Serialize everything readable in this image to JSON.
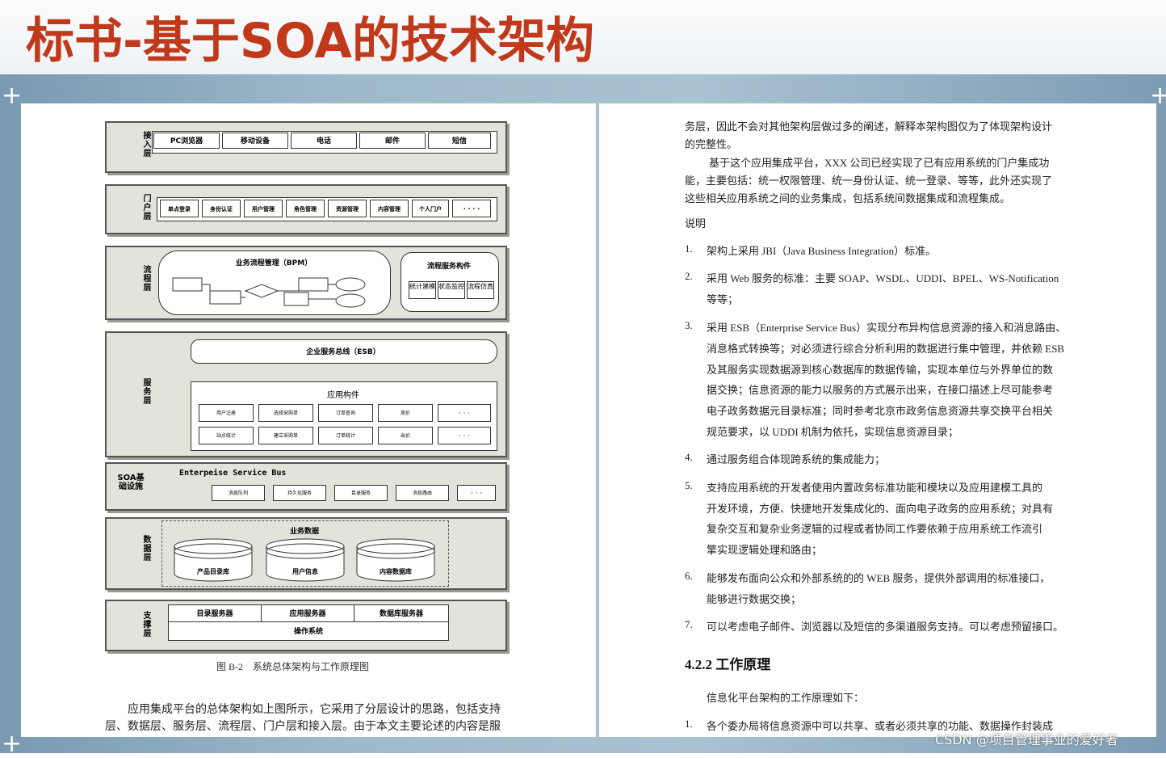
{
  "slide_title": "标书-基于SOA的技术架构",
  "diagram": {
    "access_layer": {
      "label": "接入层",
      "items": [
        "PC浏览器",
        "移动设备",
        "电话",
        "邮件",
        "短信"
      ]
    },
    "portal_layer": {
      "label": "门户层",
      "items": [
        "单点登录",
        "身份认证",
        "用户管理",
        "角色管理",
        "资源管理",
        "内容管理",
        "个人门户",
        "· · · ·"
      ]
    },
    "process_layer": {
      "label": "流程层",
      "bpm_title": "业务流程管理（BPM）",
      "components_title": "流程服务构件",
      "components": [
        "统计建模",
        "状态监控",
        "流程仿真"
      ]
    },
    "service_layer": {
      "label": "服务层",
      "esb": "企业服务总线（ESB）",
      "app_title": "应用构件",
      "row1": [
        "用户注册",
        "选择采购单",
        "订单查询",
        "竞价",
        "· · ·"
      ],
      "row2": [
        "站点统计",
        "建立采购单",
        "订单统计",
        "出价",
        "· · ·"
      ]
    },
    "soa_layer": {
      "label": "SOA基础设施",
      "bus": "Enterpeise Service Bus",
      "items": [
        "消息队列",
        "持久化服务",
        "目录服务",
        "消息路由",
        "· · ·"
      ]
    },
    "data_layer": {
      "label": "数据层",
      "title": "业务数据",
      "dbs": [
        "产品目录库",
        "用户信息",
        "内容数据库"
      ]
    },
    "support_layer": {
      "label": "支撑层",
      "items": [
        "目录服务器",
        "应用服务器",
        "数据库服务器"
      ],
      "os": "操作系统"
    },
    "caption": "图 B-2　系统总体架构与工作原理图"
  },
  "left_text": [
    "应用集成平台的总体架构如上图所示，它采用了分层设计的思路，包括支持",
    "层、数据层、服务层、流程层、门户层和接入层。由于本文主要论述的内容是服"
  ],
  "right_text": {
    "p1": [
      "务层，因此不会对其他架构层做过多的阐述，解释本架构图仅为了体现架构设计",
      "的完整性。"
    ],
    "p2": [
      "基于这个应用集成平台，XXX 公司已经实现了已有应用系统的门户集成功",
      "能，主要包括：统一权限管理、统一身份认证、统一登录、等等，此外还实现了",
      "这些相关应用系统之间的业务集成，包括系统间数据集成和流程集成。"
    ],
    "note": "说明",
    "items": [
      {
        "num": "1.",
        "lines": [
          "架构上采用 JBI（Java Business Integration）标准。"
        ]
      },
      {
        "num": "2.",
        "lines": [
          "采用 Web 服务的标准：主要 SOAP、WSDL、UDDI、BPEL、WS-Notification",
          "等等；"
        ]
      },
      {
        "num": "3.",
        "lines": [
          "采用 ESB（Enterprise Service Bus）实现分布异构信息资源的接入和消息路由、",
          "消息格式转换等；对必须进行综合分析利用的数据进行集中管理，并依赖 ESB",
          "及其服务实现数据源到核心数据库的数据传输，实现本单位与外界单位的数",
          "据交换；信息资源的能力以服务的方式展示出来，在接口描述上尽可能参考",
          "电子政务数据元目录标准；同时参考北京市政务信息资源共享交换平台相关",
          "规范要求，以 UDDI 机制为依托，实现信息资源目录；"
        ]
      },
      {
        "num": "4.",
        "lines": [
          "通过服务组合体现跨系统的集成能力；"
        ]
      },
      {
        "num": "5.",
        "lines": [
          "支持应用系统的开发者使用内置政务标准功能和模块以及应用建模工具的",
          "开发环境，方便、快捷地开发集成化的、面向电子政务的应用系统；对具有",
          "复杂交互和复杂业务逻辑的过程或者协同工作要依赖于应用系统工作流引",
          "擎实现逻辑处理和路由；"
        ]
      },
      {
        "num": "6.",
        "lines": [
          "能够发布面向公众和外部系统的的 WEB 服务，提供外部调用的标准接口，",
          "能够进行数据交换；"
        ]
      },
      {
        "num": "7.",
        "lines": [
          "可以考虑电子邮件、浏览器以及短信的多渠道服务支持。可以考虑预留接口。"
        ]
      }
    ],
    "heading": "4.2.2  工作原理",
    "p3": "信息化平台架构的工作原理如下：",
    "item_last": {
      "num": "1.",
      "line": "各个委办局将信息资源中可以共享、或者必须共享的功能、数据操作封装成"
    }
  },
  "watermark": "CSDN @项目管理事业的爱好者"
}
